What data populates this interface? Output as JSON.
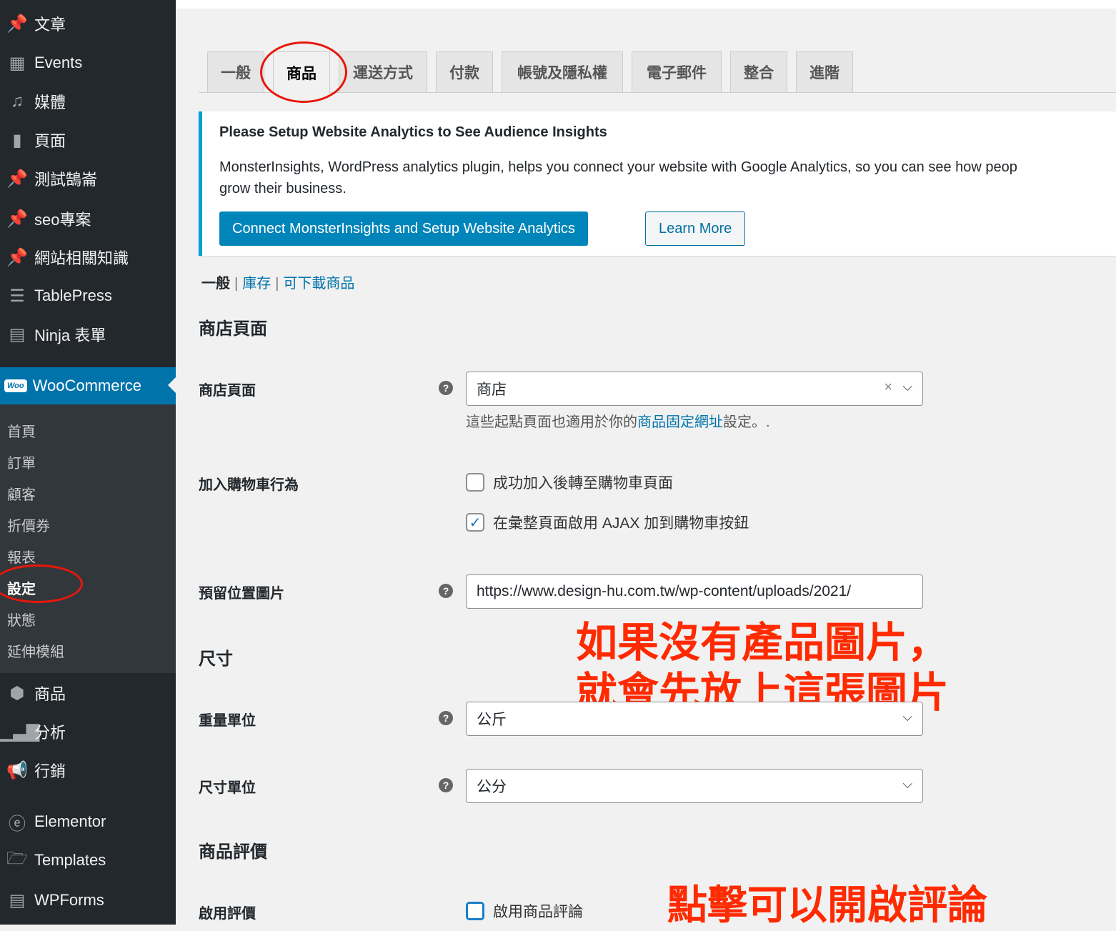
{
  "sidebar": {
    "items": [
      {
        "label": "文章",
        "icon": "pin-icon"
      },
      {
        "label": "Events",
        "icon": "calendar-icon"
      },
      {
        "label": "媒體",
        "icon": "media-icon"
      },
      {
        "label": "頁面",
        "icon": "page-icon"
      },
      {
        "label": "測試鵠崙",
        "icon": "pin-icon"
      },
      {
        "label": "seo專案",
        "icon": "pin-icon"
      },
      {
        "label": "網站相關知識",
        "icon": "pin-icon"
      },
      {
        "label": "TablePress",
        "icon": "table-icon"
      },
      {
        "label": "Ninja 表單",
        "icon": "form-icon"
      },
      {
        "label": "WooCommerce",
        "icon": "woo-icon",
        "badge": "Woo"
      },
      {
        "label": "商品",
        "icon": "box-icon"
      },
      {
        "label": "分析",
        "icon": "chart-icon"
      },
      {
        "label": "行銷",
        "icon": "megaphone-icon"
      },
      {
        "label": "Elementor",
        "icon": "elementor-icon"
      },
      {
        "label": "Templates",
        "icon": "folder-icon"
      },
      {
        "label": "WPForms",
        "icon": "wpforms-icon"
      }
    ],
    "submenu": [
      "首頁",
      "訂單",
      "顧客",
      "折價券",
      "報表",
      "設定",
      "狀態",
      "延伸模組"
    ]
  },
  "tabs": [
    "一般",
    "商品",
    "運送方式",
    "付款",
    "帳號及隱私權",
    "電子郵件",
    "整合",
    "進階"
  ],
  "notice": {
    "title": "Please Setup Website Analytics to See Audience Insights",
    "text": "MonsterInsights, WordPress analytics plugin, helps you connect your website with Google Analytics, so you can see how peop",
    "text2": "grow their business.",
    "primary": "Connect MonsterInsights and Setup Website Analytics",
    "secondary": "Learn More"
  },
  "subsub": {
    "current": "一般",
    "links": [
      "庫存",
      "可下載商品"
    ],
    "sep": "|"
  },
  "sections": {
    "shop": "商店頁面",
    "size": "尺寸",
    "reviews": "商品評價"
  },
  "fields": {
    "shop_page": {
      "label": "商店頁面",
      "value": "商店",
      "desc_pre": "這些起點頁面也適用於你的",
      "desc_link": "商品固定網址",
      "desc_post": "設定。."
    },
    "cart": {
      "label": "加入購物車行為",
      "opt1": "成功加入後轉至購物車頁面",
      "opt1_checked": false,
      "opt2": "在彙整頁面啟用 AJAX 加到購物車按鈕",
      "opt2_checked": true
    },
    "placeholder": {
      "label": "預留位置圖片",
      "value": "https://www.design-hu.com.tw/wp-content/uploads/2021/"
    },
    "weight": {
      "label": "重量單位",
      "value": "公斤"
    },
    "dimension": {
      "label": "尺寸單位",
      "value": "公分"
    },
    "reviews": {
      "label": "啟用評價",
      "opt": "啟用商品評論",
      "checked": false
    }
  },
  "annotations": {
    "line1": "如果沒有產品圖片，",
    "line2": "就會先放上這張圖片",
    "line3": "點擊可以開啟評論",
    "color": "#ff2a00"
  }
}
